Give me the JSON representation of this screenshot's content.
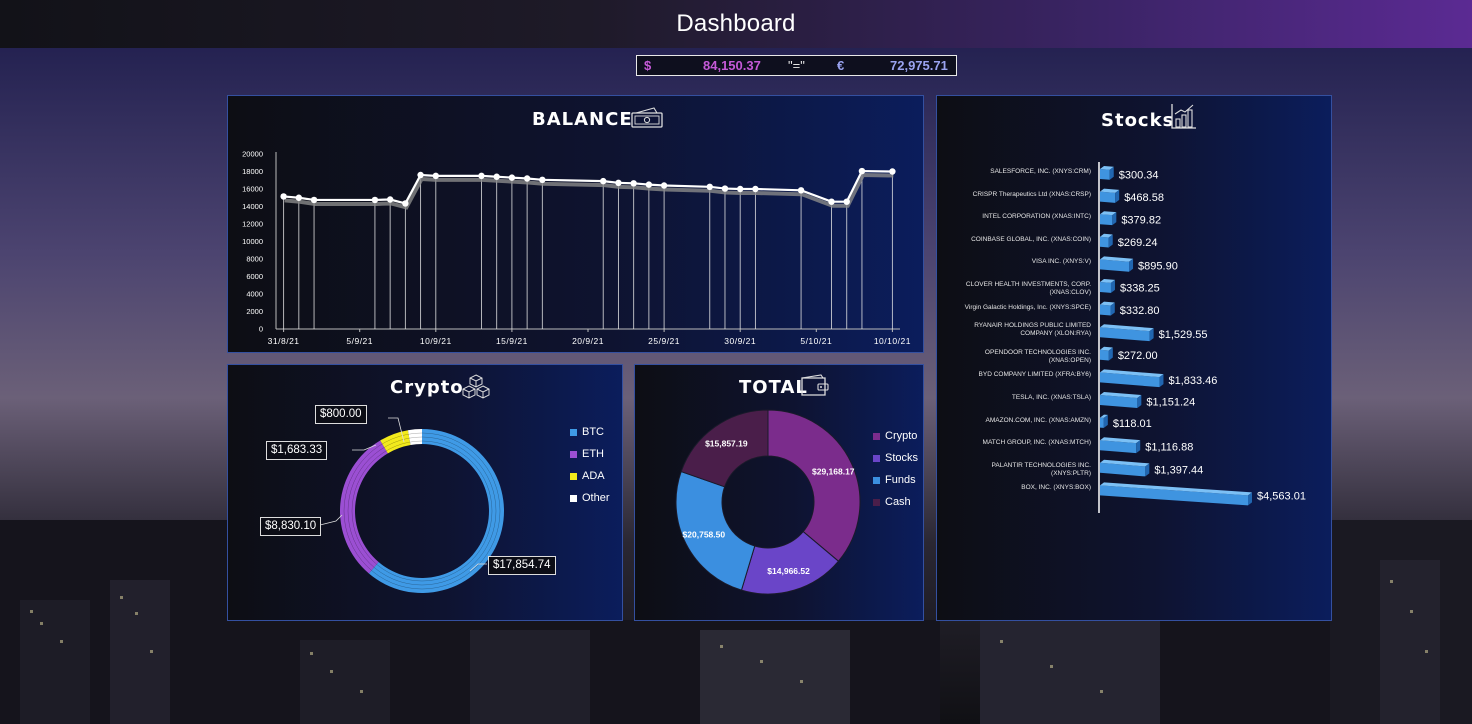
{
  "header": {
    "title": "Dashboard"
  },
  "conversion": {
    "usd_symbol": "$",
    "usd_value": "84,150.37",
    "equals": "\"=\"",
    "eur_symbol": "€",
    "eur_value": "72,975.71"
  },
  "panels": {
    "balance_title": "BALANCE",
    "stocks_title": "Stocks",
    "crypto_title": "Crypto",
    "total_title": "TOTAL"
  },
  "icons": {
    "balance": "money-bill-icon",
    "stocks": "bar-chart-icon",
    "crypto": "cubes-icon",
    "total": "wallet-icon"
  },
  "colors": {
    "btc": "#3f9ae6",
    "eth": "#9b4fd3",
    "ada": "#f2ea1c",
    "other": "#ffffff",
    "crypto": "#7b2c8c",
    "stocks": "#6a45c8",
    "funds": "#3b8fe0",
    "cash": "#4a1e4a"
  },
  "chart_data": [
    {
      "type": "line",
      "title": "BALANCE",
      "x_tick_labels": [
        "31/8/21",
        "5/9/21",
        "10/9/21",
        "15/9/21",
        "20/9/21",
        "25/9/21",
        "30/9/21",
        "5/10/21",
        "10/10/21"
      ],
      "y_tick_labels": [
        "0",
        "2000",
        "4000",
        "6000",
        "8000",
        "10000",
        "12000",
        "14000",
        "16000",
        "18000",
        "20000"
      ],
      "ylim": [
        0,
        20000
      ],
      "x": [
        "31/8/21",
        "1/9/21",
        "2/9/21",
        "6/9/21",
        "7/9/21",
        "8/9/21",
        "9/9/21",
        "10/9/21",
        "13/9/21",
        "14/9/21",
        "15/9/21",
        "16/9/21",
        "17/9/21",
        "21/9/21",
        "22/9/21",
        "23/9/21",
        "24/9/21",
        "25/9/21",
        "28/9/21",
        "29/9/21",
        "30/9/21",
        "1/10/21",
        "4/10/21",
        "6/10/21",
        "7/10/21",
        "8/10/21",
        "10/10/21"
      ],
      "values": [
        15150,
        15000,
        14750,
        14750,
        14800,
        14350,
        17600,
        17500,
        17500,
        17400,
        17300,
        17200,
        17050,
        16900,
        16700,
        16650,
        16500,
        16400,
        16250,
        16050,
        16000,
        16000,
        15850,
        14550,
        14550,
        18050,
        18000
      ],
      "grid": false
    },
    {
      "type": "bar",
      "title": "Stocks",
      "categories": [
        "SALESFORCE, INC. (XNYS:CRM)",
        "CRISPR Therapeutics Ltd (XNAS:CRSP)",
        "INTEL CORPORATION (XNAS:INTC)",
        "COINBASE GLOBAL, INC. (XNAS:COIN)",
        "VISA INC. (XNYS:V)",
        "CLOVER HEALTH INVESTMENTS, CORP. (XNAS:CLOV)",
        "Virgin Galactic Holdings, Inc. (XNYS:SPCE)",
        "RYANAIR HOLDINGS PUBLIC LIMITED COMPANY (XLON:RYA)",
        "OPENDOOR TECHNOLOGIES INC. (XNAS:OPEN)",
        "BYD COMPANY LIMITED (XFRA:BY6)",
        "TESLA, INC. (XNAS:TSLA)",
        "AMAZON.COM, INC. (XNAS:AMZN)",
        "MATCH GROUP, INC. (XNAS:MTCH)",
        "PALANTIR TECHNOLOGIES INC. (XNYS:PLTR)",
        "BOX, INC. (XNYS:BOX)"
      ],
      "values": [
        300.34,
        468.58,
        379.82,
        269.24,
        895.9,
        338.25,
        332.8,
        1529.55,
        272.0,
        1833.46,
        1151.24,
        118.01,
        1116.88,
        1397.44,
        4563.01
      ],
      "labels": [
        "$300.34",
        "$468.58",
        "$379.82",
        "$269.24",
        "$895.90",
        "$338.25",
        "$332.80",
        "$1,529.55",
        "$272.00",
        "$1,833.46",
        "$1,151.24",
        "$118.01",
        "$1,116.88",
        "$1,397.44",
        "$4,563.01"
      ],
      "orientation": "horizontal"
    },
    {
      "type": "pie",
      "title": "Crypto",
      "categories": [
        "BTC",
        "ETH",
        "ADA",
        "Other"
      ],
      "values": [
        17854.74,
        8830.1,
        1683.33,
        800.0
      ],
      "labels": [
        "$17,854.74",
        "$8,830.10",
        "$1,683.33",
        "$800.00"
      ],
      "legend": "right"
    },
    {
      "type": "pie",
      "title": "TOTAL",
      "categories": [
        "Crypto",
        "Stocks",
        "Funds",
        "Cash"
      ],
      "values": [
        29168.17,
        14966.52,
        20758.5,
        15857.19
      ],
      "labels": [
        "$29,168.17",
        "$14,966.52",
        "$20,758.50",
        "$15,857.19"
      ],
      "legend": "right"
    }
  ]
}
